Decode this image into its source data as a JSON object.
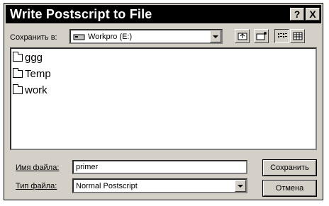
{
  "window": {
    "title": "Write Postscript to File",
    "help_label": "?",
    "close_label": "X"
  },
  "toolbar": {
    "save_in_label": "Сохранить в:",
    "save_in_value": "Workpro (E:)",
    "icons": [
      "drive-icon",
      "up-folder-icon",
      "new-folder-icon",
      "list-view-icon",
      "details-view-icon"
    ]
  },
  "files": [
    {
      "name": "ggg"
    },
    {
      "name": "Temp"
    },
    {
      "name": "work"
    }
  ],
  "form": {
    "filename_label": "Имя файла:",
    "filename_value": "primer",
    "filetype_label": "Тип файла:",
    "filetype_value": "Normal Postscript"
  },
  "buttons": {
    "save_label": "Сохранить",
    "cancel_label": "Отмена"
  }
}
